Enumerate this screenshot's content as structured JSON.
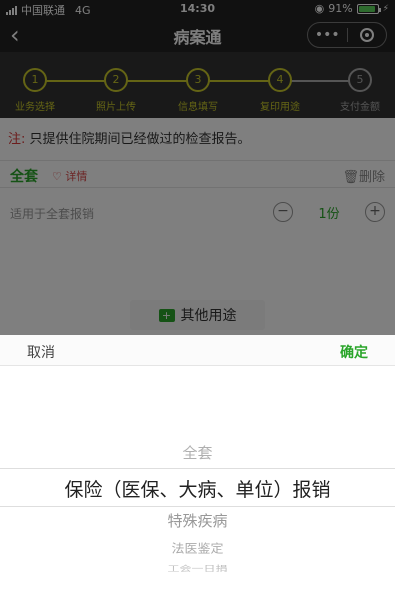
{
  "status_bar": {
    "carrier": "中国联通",
    "network": "4G",
    "time": "14:30",
    "battery": "91%",
    "battery_level": 0.91
  },
  "nav": {
    "title": "病案通"
  },
  "steps": [
    {
      "number": "1",
      "label": "业务选择"
    },
    {
      "number": "2",
      "label": "照片上传"
    },
    {
      "number": "3",
      "label": "信息填写"
    },
    {
      "number": "4",
      "label": "复印用途"
    },
    {
      "number": "5",
      "label": "支付金额"
    }
  ],
  "notice": {
    "prefix": "注:",
    "text": "只提供住院期间已经做过的检查报告。"
  },
  "item": {
    "name": "全套",
    "detail": "详情",
    "delete": "删除",
    "applies": "适用于全套报销",
    "quantity": "1份"
  },
  "other_use_button": "其他用途",
  "picker": {
    "cancel": "取消",
    "confirm": "确定",
    "options": [
      "全套",
      "保险（医保、大病、单位）报销",
      "特殊疾病",
      "法医鉴定",
      "工会一日捐"
    ],
    "selected_index": 1
  },
  "colors": {
    "accent": "#2aa52a",
    "notice_red": "#d93a3a"
  }
}
